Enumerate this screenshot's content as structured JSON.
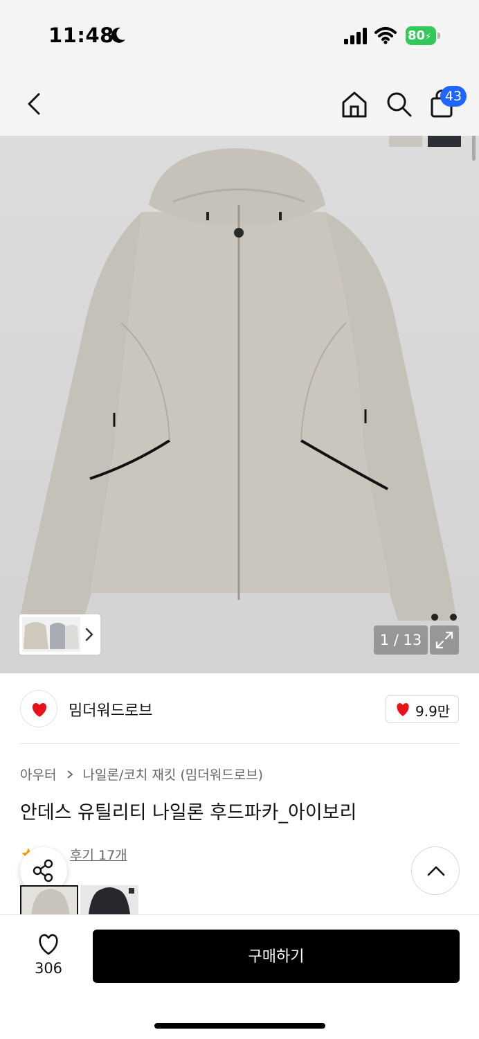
{
  "status_bar": {
    "time": "11:48",
    "battery": "80",
    "icons": [
      "moon-icon",
      "signal-icon",
      "wifi-icon",
      "battery-icon"
    ]
  },
  "nav": {
    "cart_badge": "43",
    "icons": [
      "back-icon",
      "home-icon",
      "search-icon",
      "cart-icon"
    ]
  },
  "gallery": {
    "counter": "1 / 13",
    "swatches": [
      "#c9c6bf",
      "#2c2f36"
    ]
  },
  "brand": {
    "name": "밈더워드로브",
    "likes": "9.9만"
  },
  "product": {
    "breadcrumb": [
      "아우터",
      "나일론/코치 재킷 (밈더워드로브)"
    ],
    "title": "안데스 유틸리티 나일론 후드파카_아이보리",
    "reviews": "후기 17개"
  },
  "bottom_bar": {
    "wish_count": "306",
    "buy_label": "구매하기"
  },
  "colors": {
    "accent": "#1e66ff",
    "like": "#e8121a",
    "star": "#ff9a00",
    "battery": "#34c759"
  }
}
